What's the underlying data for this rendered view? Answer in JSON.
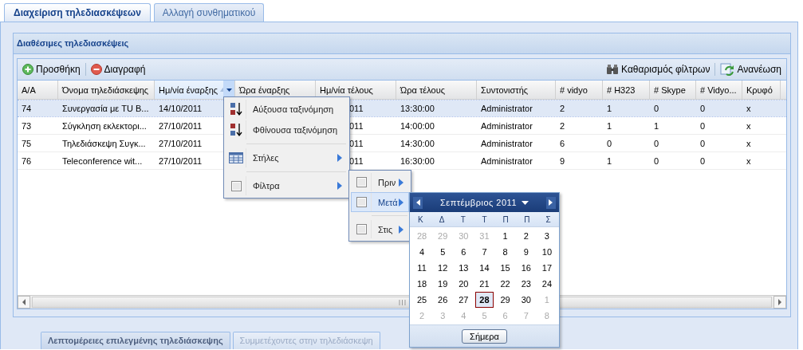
{
  "tabs": [
    {
      "label": "Διαχείριση τηλεδιασκέψεων",
      "selected": true
    },
    {
      "label": "Αλλαγή συνθηματικού",
      "selected": false
    }
  ],
  "panel": {
    "title": "Διαθέσιμες τηλεδιασκέψεις"
  },
  "toolbar": {
    "left": [
      {
        "kind": "add",
        "label": "Προσθήκη"
      },
      {
        "kind": "delete",
        "label": "Διαγραφή"
      }
    ],
    "right": [
      {
        "kind": "clear-filters",
        "label": "Καθαρισμός φίλτρων"
      },
      {
        "kind": "refresh",
        "label": "Ανανέωση"
      }
    ]
  },
  "columns": [
    {
      "label": "Α/Α",
      "active": false
    },
    {
      "label": "Όνομα τηλεδιάσκεψης",
      "active": false
    },
    {
      "label": "Ημ/νία έναρξης",
      "active": true,
      "sorted_ascending": true
    },
    {
      "label": "Ώρα έναρξης",
      "active": false
    },
    {
      "label": "Ημ/νία τέλους",
      "active": false
    },
    {
      "label": "Ώρα τέλους",
      "active": false
    },
    {
      "label": "Συντονιστής",
      "active": false
    },
    {
      "label": "# vidyo",
      "active": false
    },
    {
      "label": "# H323",
      "active": false
    },
    {
      "label": "# Skype",
      "active": false
    },
    {
      "label": "# Vidyo...",
      "active": false
    },
    {
      "label": "Κρυφό",
      "active": false
    }
  ],
  "rows": [
    {
      "selected": true,
      "cells": [
        "74",
        "Συνεργασία με TU B...",
        "14/10/2011",
        null,
        "011",
        "13:30:00",
        "Administrator",
        "2",
        "1",
        "0",
        "0",
        "x"
      ]
    },
    {
      "selected": false,
      "cells": [
        "73",
        "Σύγκληση εκλεκτορι...",
        "27/10/2011",
        null,
        "011",
        "14:00:00",
        "Administrator",
        "2",
        "1",
        "1",
        "0",
        "x"
      ]
    },
    {
      "selected": false,
      "cells": [
        "75",
        "Τηλεδιάσκεψη Συγκ...",
        "27/10/2011",
        null,
        "011",
        "14:30:00",
        "Administrator",
        "6",
        "0",
        "0",
        "0",
        "x"
      ]
    },
    {
      "selected": false,
      "cells": [
        "76",
        "Teleconference wit...",
        "27/10/2011",
        null,
        "011",
        "16:30:00",
        "Administrator",
        "9",
        "1",
        "0",
        "0",
        "x"
      ]
    }
  ],
  "column_menu": {
    "groups": [
      [
        {
          "kind": "sort-asc",
          "label": "Αύξουσα ταξινόμηση"
        },
        {
          "kind": "sort-desc",
          "label": "Φθίνουσα ταξινόμηση"
        }
      ],
      [
        {
          "kind": "columns",
          "label": "Στήλες",
          "submenu": true
        }
      ],
      [
        {
          "kind": "filter",
          "label": "Φίλτρα",
          "checked": false,
          "submenu": true
        }
      ]
    ]
  },
  "filter_menu": {
    "groups": [
      [
        {
          "label": "Πριν",
          "checked": false,
          "active": false
        },
        {
          "label": "Μετά",
          "checked": false,
          "active": true
        }
      ],
      [
        {
          "label": "Στις",
          "checked": false,
          "active": false
        }
      ]
    ]
  },
  "calendar": {
    "month": "Σεπτέμβριος 2011",
    "weekdays": [
      "Κ",
      "Δ",
      "Τ",
      "Τ",
      "Π",
      "Π",
      "Σ"
    ],
    "days": [
      {
        "day": "28",
        "muted": true,
        "selected": false
      },
      {
        "day": "29",
        "muted": true,
        "selected": false
      },
      {
        "day": "30",
        "muted": true,
        "selected": false
      },
      {
        "day": "31",
        "muted": true,
        "selected": false
      },
      {
        "day": "1",
        "muted": false,
        "selected": false
      },
      {
        "day": "2",
        "muted": false,
        "selected": false
      },
      {
        "day": "3",
        "muted": false,
        "selected": false
      },
      {
        "day": "4",
        "muted": false,
        "selected": false
      },
      {
        "day": "5",
        "muted": false,
        "selected": false
      },
      {
        "day": "6",
        "muted": false,
        "selected": false
      },
      {
        "day": "7",
        "muted": false,
        "selected": false
      },
      {
        "day": "8",
        "muted": false,
        "selected": false
      },
      {
        "day": "9",
        "muted": false,
        "selected": false
      },
      {
        "day": "10",
        "muted": false,
        "selected": false
      },
      {
        "day": "11",
        "muted": false,
        "selected": false
      },
      {
        "day": "12",
        "muted": false,
        "selected": false
      },
      {
        "day": "13",
        "muted": false,
        "selected": false
      },
      {
        "day": "14",
        "muted": false,
        "selected": false
      },
      {
        "day": "15",
        "muted": false,
        "selected": false
      },
      {
        "day": "16",
        "muted": false,
        "selected": false
      },
      {
        "day": "17",
        "muted": false,
        "selected": false
      },
      {
        "day": "18",
        "muted": false,
        "selected": false
      },
      {
        "day": "19",
        "muted": false,
        "selected": false
      },
      {
        "day": "20",
        "muted": false,
        "selected": false
      },
      {
        "day": "21",
        "muted": false,
        "selected": false
      },
      {
        "day": "22",
        "muted": false,
        "selected": false
      },
      {
        "day": "23",
        "muted": false,
        "selected": false
      },
      {
        "day": "24",
        "muted": false,
        "selected": false
      },
      {
        "day": "25",
        "muted": false,
        "selected": false
      },
      {
        "day": "26",
        "muted": false,
        "selected": false
      },
      {
        "day": "27",
        "muted": false,
        "selected": false
      },
      {
        "day": "28",
        "muted": false,
        "selected": true
      },
      {
        "day": "29",
        "muted": false,
        "selected": false
      },
      {
        "day": "30",
        "muted": false,
        "selected": false
      },
      {
        "day": "1",
        "muted": true,
        "selected": false
      },
      {
        "day": "2",
        "muted": true,
        "selected": false
      },
      {
        "day": "3",
        "muted": true,
        "selected": false
      },
      {
        "day": "4",
        "muted": true,
        "selected": false
      },
      {
        "day": "5",
        "muted": true,
        "selected": false
      },
      {
        "day": "6",
        "muted": true,
        "selected": false
      },
      {
        "day": "7",
        "muted": true,
        "selected": false
      },
      {
        "day": "8",
        "muted": true,
        "selected": false
      }
    ],
    "today_button": "Σήμερα"
  },
  "bottom_tabs": [
    {
      "label": "Λεπτομέρειες επιλεγμένης τηλεδιάσκεψης",
      "selected": true
    },
    {
      "label": "Συμμετέχοντες στην τηλεδιάσκεψη",
      "selected": false
    }
  ]
}
